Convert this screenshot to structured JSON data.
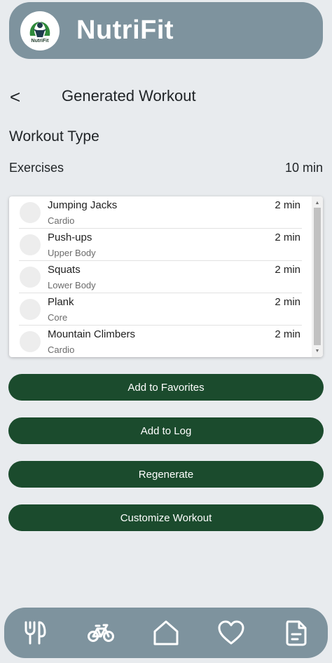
{
  "app": {
    "title": "NutriFit",
    "logo_text": "NutriFit"
  },
  "page": {
    "back_label": "<",
    "title": "Generated Workout",
    "section_title": "Workout Type",
    "exercises_label": "Exercises",
    "total_time": "10 min"
  },
  "exercises": [
    {
      "name": "Jumping Jacks",
      "category": "Cardio",
      "duration": "2 min"
    },
    {
      "name": "Push-ups",
      "category": "Upper Body",
      "duration": "2 min"
    },
    {
      "name": "Squats",
      "category": "Lower Body",
      "duration": "2 min"
    },
    {
      "name": "Plank",
      "category": "Core",
      "duration": "2 min"
    },
    {
      "name": "Mountain Climbers",
      "category": "Cardio",
      "duration": "2 min"
    }
  ],
  "actions": {
    "add_favorites": "Add to Favorites",
    "add_log": "Add to Log",
    "regenerate": "Regenerate",
    "customize": "Customize Workout"
  },
  "nav": {
    "items": [
      {
        "icon": "food-icon"
      },
      {
        "icon": "bike-icon"
      },
      {
        "icon": "home-icon"
      },
      {
        "icon": "heart-icon"
      },
      {
        "icon": "document-icon"
      }
    ]
  },
  "colors": {
    "header_bg": "#7e939e",
    "page_bg": "#e8ebee",
    "button_bg": "#1b4b2d",
    "button_text": "#ffffff"
  }
}
